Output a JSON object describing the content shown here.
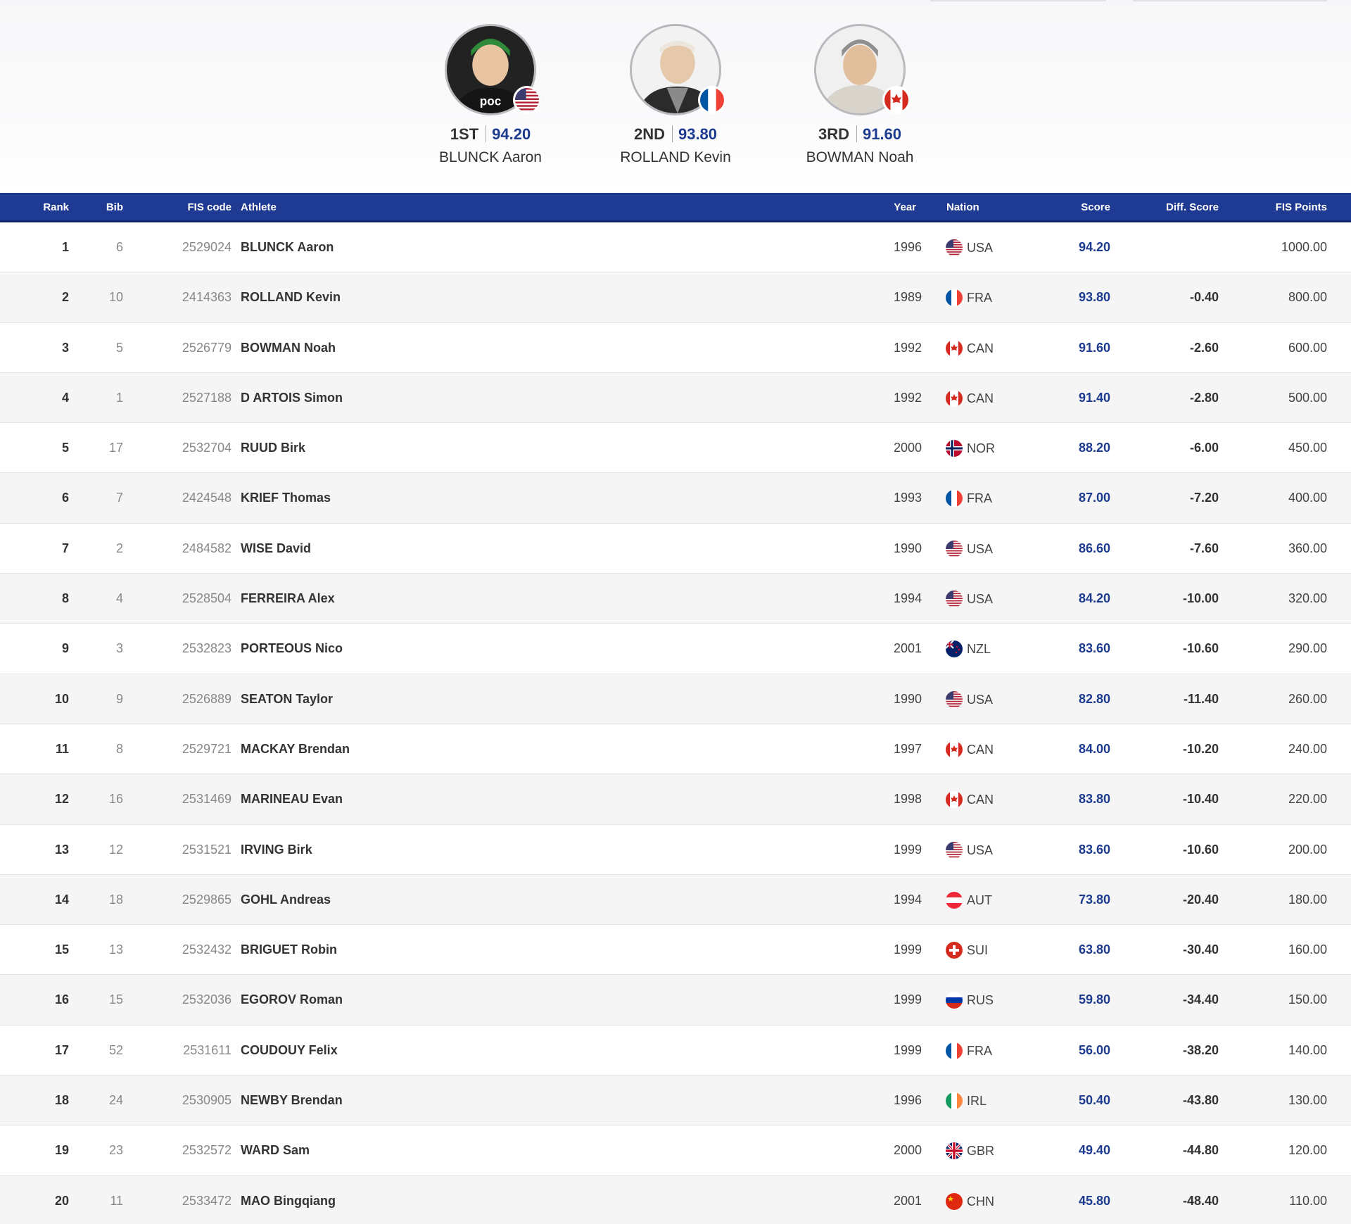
{
  "podium": [
    {
      "place": "1ST",
      "score": "94.20",
      "name": "BLUNCK Aaron",
      "nation": "USA",
      "cap_color": "#2f8a3a",
      "shirt_color": "#1a1a1a"
    },
    {
      "place": "2ND",
      "score": "93.80",
      "name": "ROLLAND Kevin",
      "nation": "FRA",
      "cap_color": "#ece6dd",
      "shirt_color": "#2b2b2b"
    },
    {
      "place": "3RD",
      "score": "91.60",
      "name": "BOWMAN Noah",
      "nation": "CAN",
      "cap_color": "#8e8e8e",
      "shirt_color": "#d8d4cc"
    }
  ],
  "headers": {
    "rank": "Rank",
    "bib": "Bib",
    "fis_code": "FIS code",
    "athlete": "Athlete",
    "year": "Year",
    "nation": "Nation",
    "score": "Score",
    "diff": "Diff. Score",
    "points": "FIS Points"
  },
  "rows": [
    {
      "rank": "1",
      "bib": "6",
      "fis": "2529024",
      "athlete": "BLUNCK Aaron",
      "year": "1996",
      "nation": "USA",
      "score": "94.20",
      "diff": "",
      "points": "1000.00"
    },
    {
      "rank": "2",
      "bib": "10",
      "fis": "2414363",
      "athlete": "ROLLAND Kevin",
      "year": "1989",
      "nation": "FRA",
      "score": "93.80",
      "diff": "-0.40",
      "points": "800.00"
    },
    {
      "rank": "3",
      "bib": "5",
      "fis": "2526779",
      "athlete": "BOWMAN Noah",
      "year": "1992",
      "nation": "CAN",
      "score": "91.60",
      "diff": "-2.60",
      "points": "600.00"
    },
    {
      "rank": "4",
      "bib": "1",
      "fis": "2527188",
      "athlete": "D ARTOIS Simon",
      "year": "1992",
      "nation": "CAN",
      "score": "91.40",
      "diff": "-2.80",
      "points": "500.00"
    },
    {
      "rank": "5",
      "bib": "17",
      "fis": "2532704",
      "athlete": "RUUD Birk",
      "year": "2000",
      "nation": "NOR",
      "score": "88.20",
      "diff": "-6.00",
      "points": "450.00"
    },
    {
      "rank": "6",
      "bib": "7",
      "fis": "2424548",
      "athlete": "KRIEF Thomas",
      "year": "1993",
      "nation": "FRA",
      "score": "87.00",
      "diff": "-7.20",
      "points": "400.00"
    },
    {
      "rank": "7",
      "bib": "2",
      "fis": "2484582",
      "athlete": "WISE David",
      "year": "1990",
      "nation": "USA",
      "score": "86.60",
      "diff": "-7.60",
      "points": "360.00"
    },
    {
      "rank": "8",
      "bib": "4",
      "fis": "2528504",
      "athlete": "FERREIRA Alex",
      "year": "1994",
      "nation": "USA",
      "score": "84.20",
      "diff": "-10.00",
      "points": "320.00"
    },
    {
      "rank": "9",
      "bib": "3",
      "fis": "2532823",
      "athlete": "PORTEOUS Nico",
      "year": "2001",
      "nation": "NZL",
      "score": "83.60",
      "diff": "-10.60",
      "points": "290.00"
    },
    {
      "rank": "10",
      "bib": "9",
      "fis": "2526889",
      "athlete": "SEATON Taylor",
      "year": "1990",
      "nation": "USA",
      "score": "82.80",
      "diff": "-11.40",
      "points": "260.00"
    },
    {
      "rank": "11",
      "bib": "8",
      "fis": "2529721",
      "athlete": "MACKAY Brendan",
      "year": "1997",
      "nation": "CAN",
      "score": "84.00",
      "diff": "-10.20",
      "points": "240.00"
    },
    {
      "rank": "12",
      "bib": "16",
      "fis": "2531469",
      "athlete": "MARINEAU Evan",
      "year": "1998",
      "nation": "CAN",
      "score": "83.80",
      "diff": "-10.40",
      "points": "220.00"
    },
    {
      "rank": "13",
      "bib": "12",
      "fis": "2531521",
      "athlete": "IRVING Birk",
      "year": "1999",
      "nation": "USA",
      "score": "83.60",
      "diff": "-10.60",
      "points": "200.00"
    },
    {
      "rank": "14",
      "bib": "18",
      "fis": "2529865",
      "athlete": "GOHL Andreas",
      "year": "1994",
      "nation": "AUT",
      "score": "73.80",
      "diff": "-20.40",
      "points": "180.00"
    },
    {
      "rank": "15",
      "bib": "13",
      "fis": "2532432",
      "athlete": "BRIGUET Robin",
      "year": "1999",
      "nation": "SUI",
      "score": "63.80",
      "diff": "-30.40",
      "points": "160.00"
    },
    {
      "rank": "16",
      "bib": "15",
      "fis": "2532036",
      "athlete": "EGOROV Roman",
      "year": "1999",
      "nation": "RUS",
      "score": "59.80",
      "diff": "-34.40",
      "points": "150.00"
    },
    {
      "rank": "17",
      "bib": "52",
      "fis": "2531611",
      "athlete": "COUDOUY Felix",
      "year": "1999",
      "nation": "FRA",
      "score": "56.00",
      "diff": "-38.20",
      "points": "140.00"
    },
    {
      "rank": "18",
      "bib": "24",
      "fis": "2530905",
      "athlete": "NEWBY Brendan",
      "year": "1996",
      "nation": "IRL",
      "score": "50.40",
      "diff": "-43.80",
      "points": "130.00"
    },
    {
      "rank": "19",
      "bib": "23",
      "fis": "2532572",
      "athlete": "WARD Sam",
      "year": "2000",
      "nation": "GBR",
      "score": "49.40",
      "diff": "-44.80",
      "points": "120.00"
    },
    {
      "rank": "20",
      "bib": "11",
      "fis": "2533472",
      "athlete": "MAO Bingqiang",
      "year": "2001",
      "nation": "CHN",
      "score": "45.80",
      "diff": "-48.40",
      "points": "110.00"
    }
  ],
  "colors": {
    "header_bg": "#1f3a93",
    "score": "#1c3a8e"
  }
}
